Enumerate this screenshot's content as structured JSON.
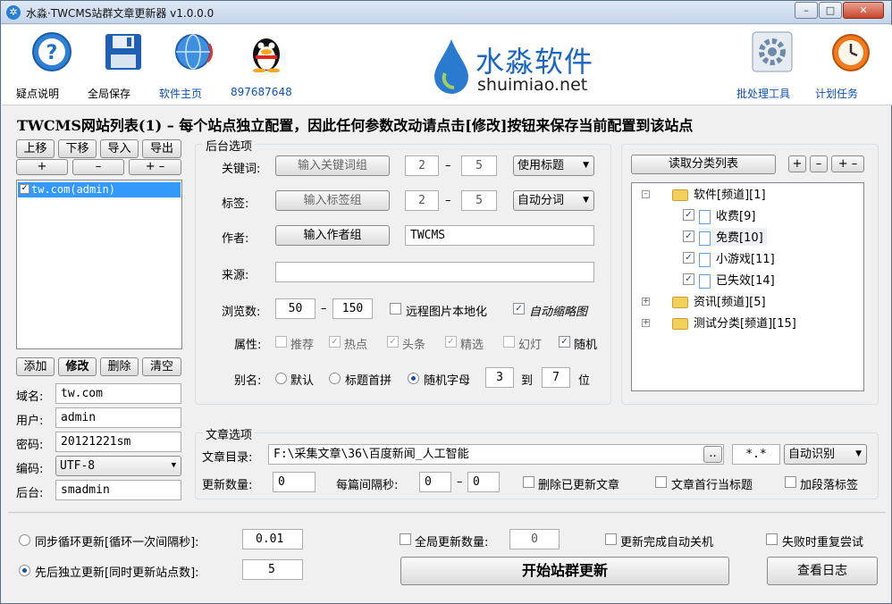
{
  "window": {
    "title": "水淼·TWCMS站群文章更新器 v1.0.0.0",
    "controls": {
      "minimize": "–",
      "maximize": "□",
      "close": "✕"
    }
  },
  "toolbar": {
    "help": "疑点说明",
    "save": "全局保存",
    "homepage": "软件主页",
    "qq": "897687648",
    "batch": "批处理工具",
    "schedule": "计划任务"
  },
  "logo": {
    "brand": "水淼软件",
    "site": "shuimiao.net"
  },
  "heading": "TWCMS网站列表(1) – 每个站点独立配置，因此任何参数改动请点击[修改]按钮来保存当前配置到该站点",
  "site_list": {
    "up": "上移",
    "down": "下移",
    "import": "导入",
    "export": "导出",
    "add_small": "+",
    "remove_small": "–",
    "plus_minus": "+ –",
    "items": [
      "tw.com(admin)"
    ],
    "add": "添加",
    "modify": "修改",
    "delete": "删除",
    "clear": "清空"
  },
  "site_fields": {
    "domain_label": "域名:",
    "domain": "tw.com",
    "user_label": "用户:",
    "user": "admin",
    "password_label": "密码:",
    "password": "20121221sm",
    "encoding_label": "编码:",
    "encoding": "UTF-8",
    "backend_label": "后台:",
    "backend": "smadmin"
  },
  "backend": {
    "title": "后台选项",
    "keyword_label": "关键词:",
    "keyword_btn": "输入关键词组",
    "keyword_min": "2",
    "keyword_max": "5",
    "keyword_mode": "使用标题",
    "tag_label": "标签:",
    "tag_btn": "输入标签组",
    "tag_min": "2",
    "tag_max": "5",
    "tag_mode": "自动分词",
    "author_label": "作者:",
    "author_btn": "输入作者组",
    "author": "TWCMS",
    "source_label": "来源:",
    "source": "",
    "views_label": "浏览数:",
    "views_min": "50",
    "views_max": "150",
    "remote_img": "远程图片本地化",
    "auto_thumb": "自动缩略图",
    "attr_label": "属性:",
    "attrs": [
      "推荐",
      "热点",
      "头条",
      "精选",
      "幻灯",
      "随机"
    ],
    "alias_label": "别名:",
    "alias_default": "默认",
    "alias_pinyin": "标题首拼",
    "alias_random": "随机字母",
    "alias_min": "3",
    "alias_to": "到",
    "alias_max": "7",
    "alias_unit": "位",
    "dash": "–"
  },
  "category": {
    "read_btn": "读取分类列表",
    "btns": [
      "+",
      "–",
      "+ –"
    ],
    "tree": [
      {
        "label": "软件[频道][1]",
        "type": "folder",
        "expanded": true
      },
      {
        "label": "收费[9]",
        "type": "doc",
        "checked": true
      },
      {
        "label": "免费[10]",
        "type": "doc",
        "checked": true
      },
      {
        "label": "小游戏[11]",
        "type": "doc",
        "checked": true
      },
      {
        "label": "已失效[14]",
        "type": "doc",
        "checked": true
      },
      {
        "label": "资讯[频道][5]",
        "type": "folder",
        "expanded": false
      },
      {
        "label": "测试分类[频道][15]",
        "type": "folder",
        "expanded": false
      }
    ]
  },
  "article": {
    "title": "文章选项",
    "dir_label": "文章目录:",
    "dir": "F:\\采集文章\\36\\百度新闻_人工智能",
    "browse": "..",
    "pattern": "*.*",
    "detect": "自动识别",
    "count_label": "更新数量:",
    "count": "0",
    "interval_label": "每篇间隔秒:",
    "interval_min": "0",
    "interval_max": "0",
    "delete_updated": "删除已更新文章",
    "first_line_title": "文章首行当标题",
    "para_tags": "加段落标签"
  },
  "bottom": {
    "sync_label": "同步循环更新[循环一次间隔秒]:",
    "sync_value": "0.01",
    "seq_label": "先后独立更新[同时更新站点数]:",
    "seq_value": "5",
    "global_count_label": "全局更新数量:",
    "global_count": "0",
    "shutdown": "更新完成自动关机",
    "retry": "失败时重复尝试",
    "start": "开始站群更新",
    "log": "查看日志"
  }
}
